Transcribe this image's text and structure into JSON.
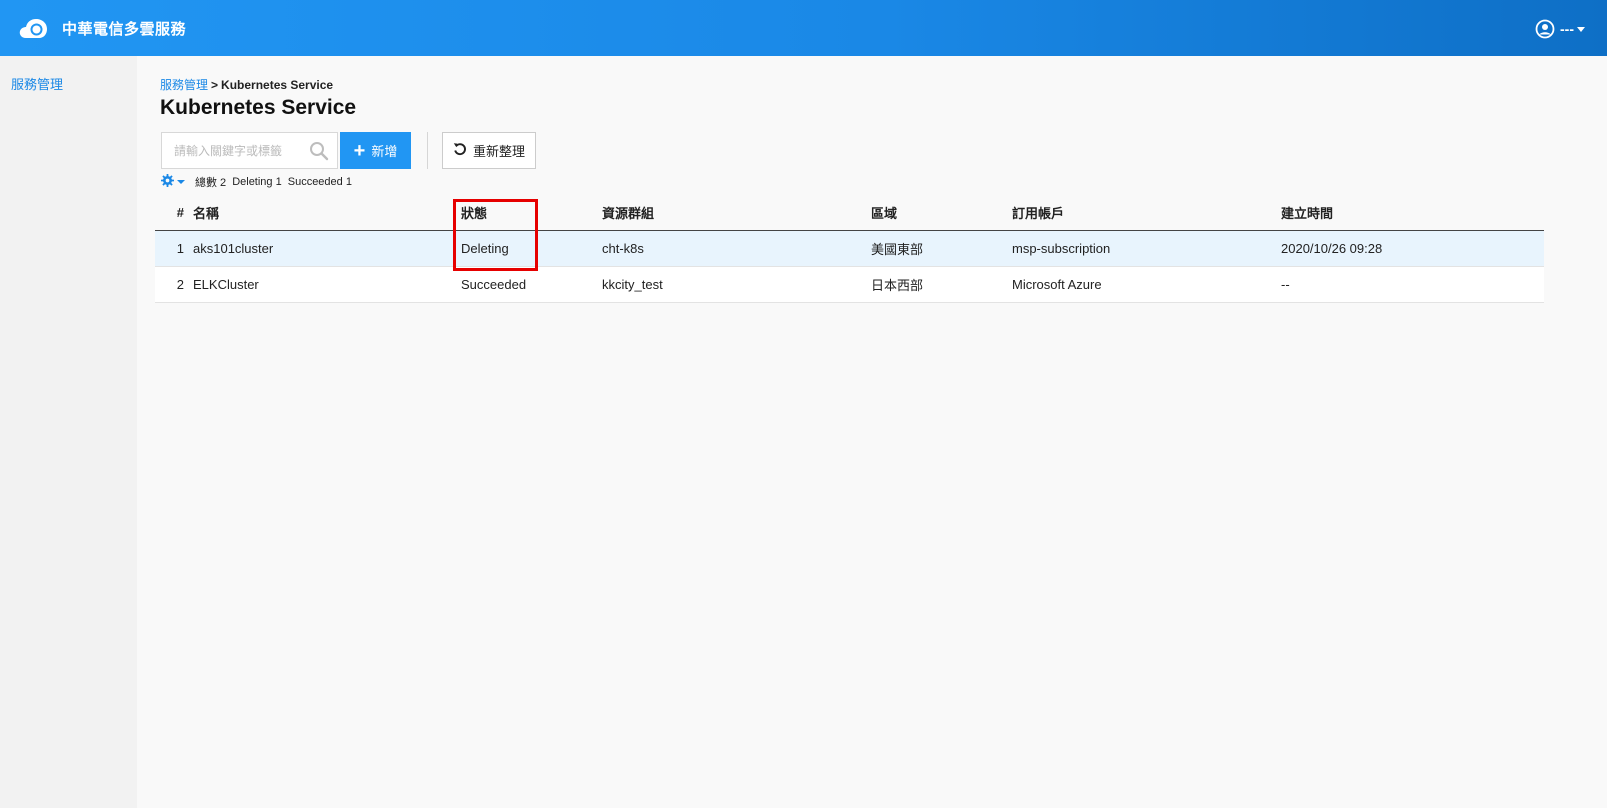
{
  "header": {
    "title": "中華電信多雲服務",
    "user_name": "---"
  },
  "sidebar": {
    "items": [
      {
        "label": "服務管理"
      }
    ]
  },
  "breadcrumb": {
    "parent": "服務管理",
    "separator": ">",
    "current": "Kubernetes Service"
  },
  "page": {
    "title": "Kubernetes Service"
  },
  "toolbar": {
    "search_placeholder": "請輸入關鍵字或標籤",
    "add_label": "新增",
    "refresh_label": "重新整理"
  },
  "summary": {
    "total_label": "總數 2",
    "deleting_label": "Deleting 1",
    "succeeded_label": "Succeeded 1"
  },
  "table": {
    "headers": {
      "idx": "#",
      "name": "名稱",
      "status": "狀態",
      "resource_group": "資源群組",
      "region": "區域",
      "subscription": "訂用帳戶",
      "created": "建立時間"
    },
    "rows": [
      {
        "idx": "1",
        "name": "aks101cluster",
        "status": "Deleting",
        "resource_group": "cht-k8s",
        "region": "美國東部",
        "subscription": "msp-subscription",
        "created": "2020/10/26 09:28"
      },
      {
        "idx": "2",
        "name": "ELKCluster",
        "status": "Succeeded",
        "resource_group": "kkcity_test",
        "region": "日本西部",
        "subscription": "Microsoft Azure",
        "created": "--"
      }
    ]
  },
  "colors": {
    "brand_blue": "#2196f3",
    "header_dark_blue": "#0e6fc6",
    "link_blue": "#1a88e6",
    "selected_row": "#e8f4fd",
    "highlight_red": "#e60000"
  },
  "icons": {
    "logo": "cloud-logo-icon",
    "user": "user-circle-icon",
    "search": "search-icon",
    "add": "plus-icon",
    "refresh": "refresh-icon",
    "settings": "gear-icon"
  }
}
